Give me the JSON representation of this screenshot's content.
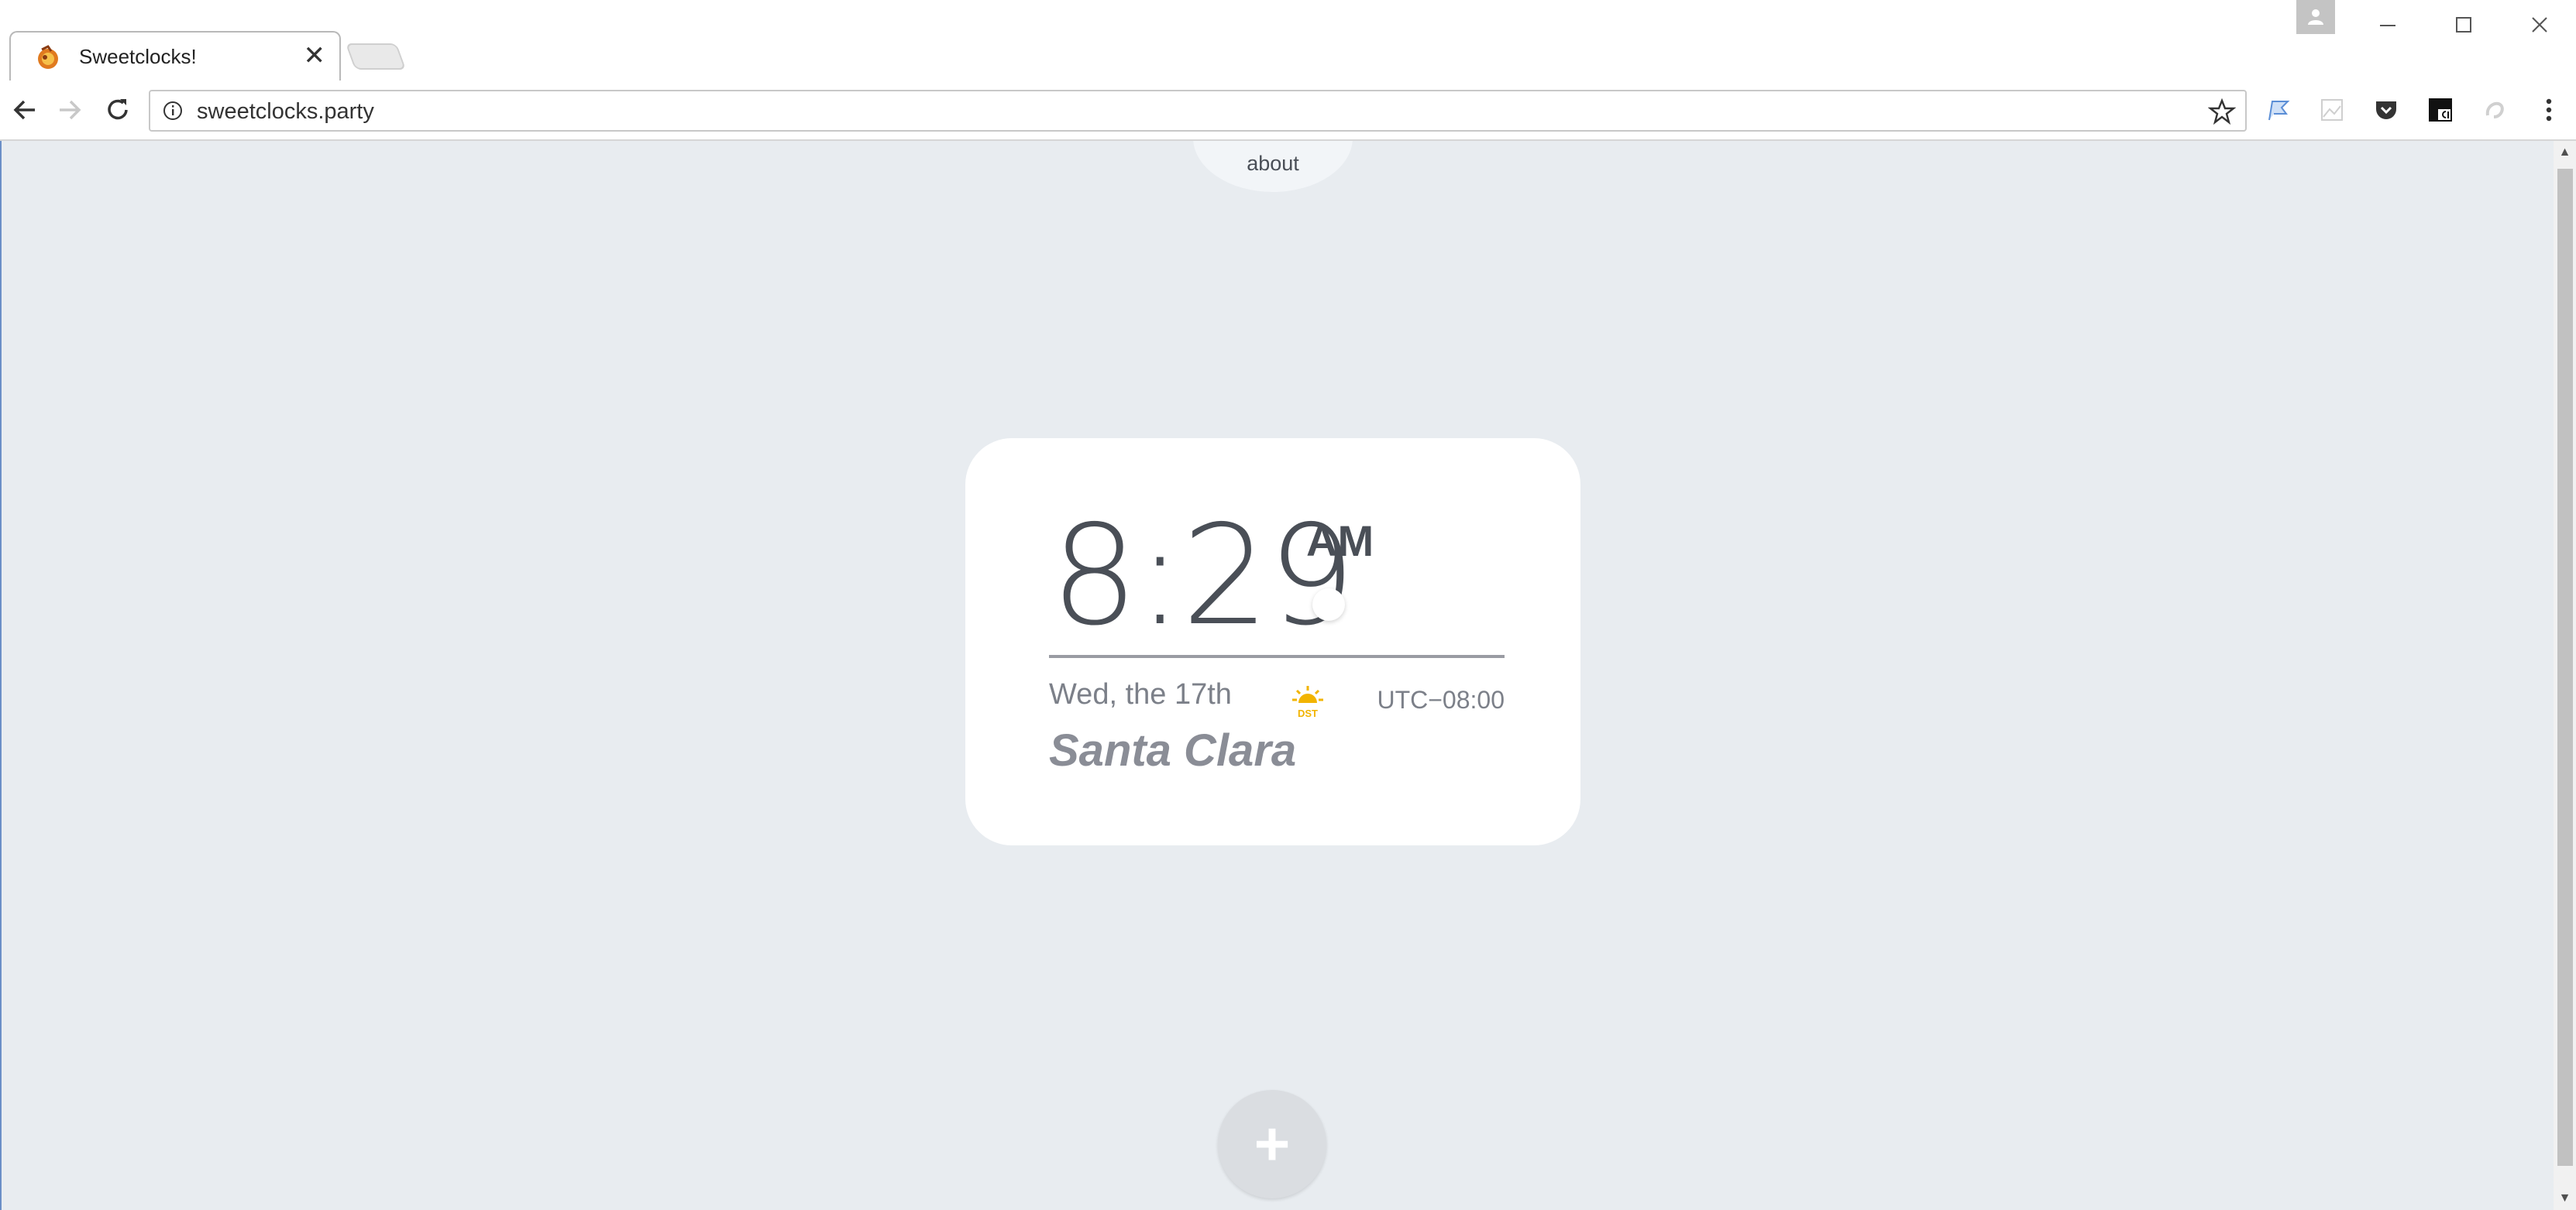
{
  "browser": {
    "tab": {
      "title": "Sweetclocks!",
      "close_label": "✕"
    },
    "url": "sweetclocks.party"
  },
  "page": {
    "about_label": "about",
    "clock": {
      "time": "8:29",
      "ampm": "AM",
      "date": "Wed, the 17th",
      "dst_label": "DST",
      "utc_offset": "UTC−08:00",
      "city": "Santa Clara"
    },
    "add_button_label": "+"
  },
  "colors": {
    "page_background": "#e8ecf0",
    "card_background": "#ffffff",
    "text_dark": "#4a4f57",
    "text_muted": "#7c8089",
    "dst_accent": "#f2b400"
  },
  "icons": [
    "back-icon",
    "forward-icon",
    "reload-icon",
    "info-icon",
    "star-icon",
    "profile-icon",
    "minimize-icon",
    "maximize-icon",
    "close-window-icon",
    "extension-flag-icon",
    "extension-image-icon",
    "pocket-icon",
    "extension-ci-icon",
    "extension-swirl-icon",
    "menu-icon",
    "favicon-icon",
    "dst-sun-icon"
  ]
}
